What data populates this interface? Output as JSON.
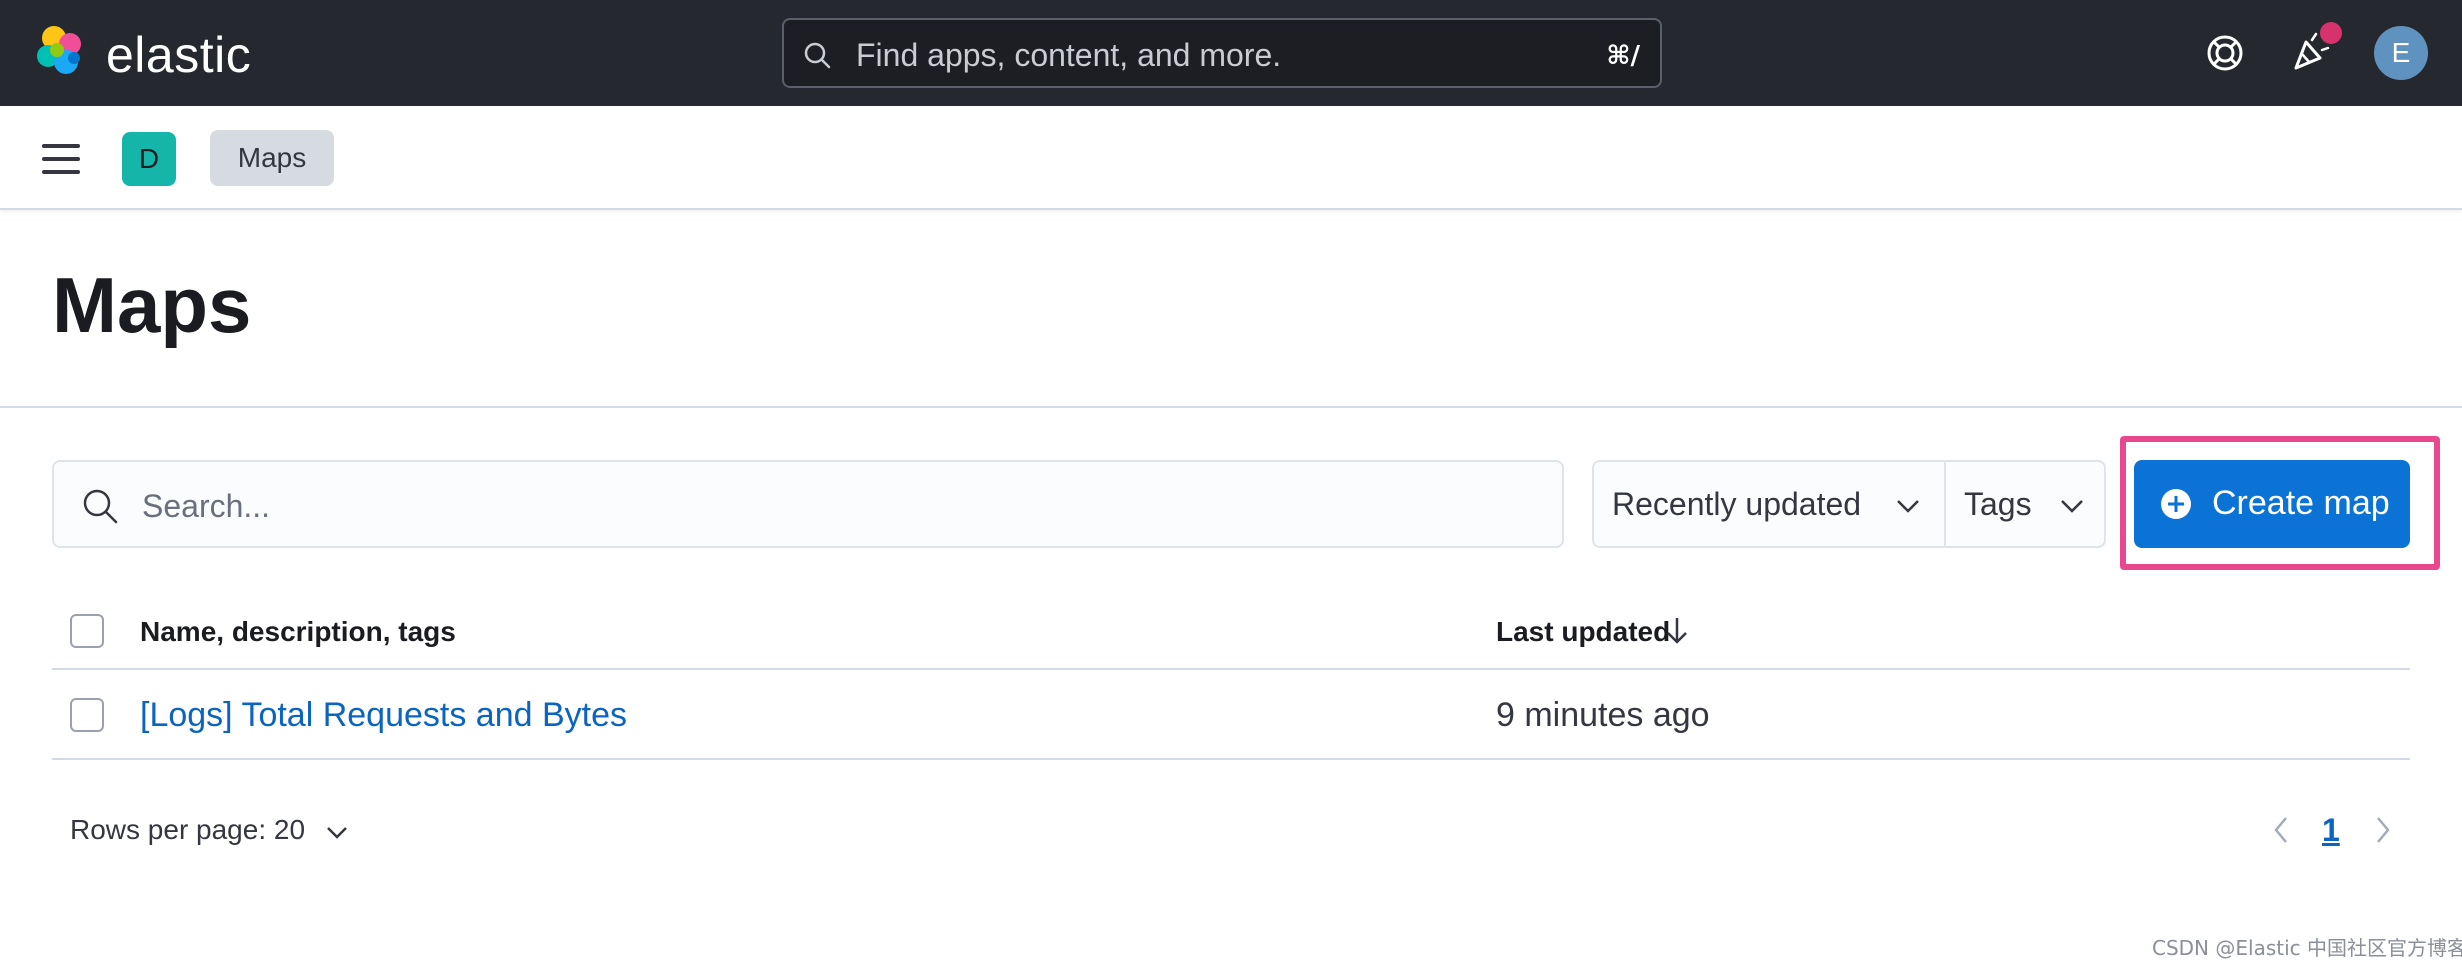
{
  "header": {
    "brand": "elastic",
    "search_placeholder": "Find apps, content, and more.",
    "search_shortcut": "⌘/",
    "help_icon": "help-icon",
    "news_icon": "newsfeed-icon",
    "user_initial": "E",
    "colors": {
      "background": "#25282f",
      "news_dot": "#d6336c",
      "avatar": "#6092c0"
    }
  },
  "subheader": {
    "space_initial": "D",
    "breadcrumb": "Maps",
    "colors": {
      "space_badge": "#15b5aa"
    }
  },
  "page": {
    "title": "Maps"
  },
  "toolbar": {
    "search_placeholder": "Search...",
    "sort_label": "Recently updated",
    "tags_label": "Tags",
    "create_label": "Create map",
    "colors": {
      "create_button": "#0b72d6",
      "highlight": "#e9488e"
    }
  },
  "table": {
    "columns": [
      "Name, description, tags",
      "Last updated"
    ],
    "sort_direction_icon": "arrow-down-icon",
    "rows": [
      {
        "title": "[Logs] Total Requests and Bytes",
        "updated": "9 minutes ago"
      }
    ]
  },
  "footer": {
    "rows_per_page": "Rows per page: 20",
    "current_page": "1"
  },
  "watermark": "CSDN @Elastic 中国社区官方博客"
}
